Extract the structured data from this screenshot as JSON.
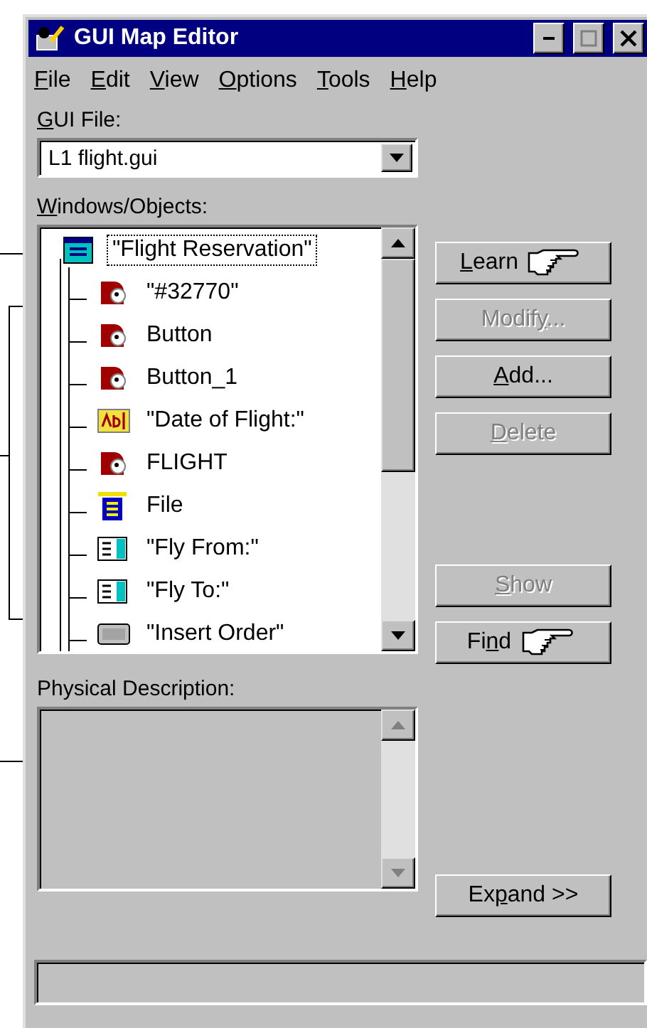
{
  "window": {
    "title": "GUI Map Editor"
  },
  "menu": [
    {
      "key": "F",
      "after": "ile"
    },
    {
      "key": "E",
      "after": "dit"
    },
    {
      "key": "V",
      "after": "iew"
    },
    {
      "key": "O",
      "after": "ptions"
    },
    {
      "key": "T",
      "after": "ools"
    },
    {
      "key": "H",
      "after": "elp"
    }
  ],
  "gui_file": {
    "label": {
      "key": "G",
      "after": "UI File:"
    },
    "value": "L1  flight.gui"
  },
  "objects": {
    "label": {
      "key": "W",
      "after": "indows/Objects:"
    },
    "tree": [
      {
        "label": "\"Flight Reservation\"",
        "kind": "window",
        "selected": true,
        "children": [
          {
            "label": "\"#32770\"",
            "kind": "object",
            "selected": false
          },
          {
            "label": "Button",
            "kind": "object",
            "selected": false
          },
          {
            "label": "Button_1",
            "kind": "object",
            "selected": false
          },
          {
            "label": "\"Date of Flight:\"",
            "kind": "edit",
            "selected": false
          },
          {
            "label": "FLIGHT",
            "kind": "object",
            "selected": false
          },
          {
            "label": "File",
            "kind": "menu",
            "selected": false
          },
          {
            "label": "\"Fly From:\"",
            "kind": "list",
            "selected": false
          },
          {
            "label": "\"Fly To:\"",
            "kind": "list",
            "selected": false
          },
          {
            "label": "\"Insert Order\"",
            "kind": "push",
            "selected": false
          }
        ]
      }
    ]
  },
  "buttons_top": [
    {
      "key": "L",
      "after": "earn",
      "disabled": false,
      "hand": true
    },
    {
      "before": "Modif",
      "key": "y",
      "after": "...",
      "disabled": true
    },
    {
      "key": "A",
      "after": "dd...",
      "disabled": false
    },
    {
      "key": "D",
      "after": "elete",
      "disabled": true
    }
  ],
  "buttons_bottom": [
    {
      "key": "S",
      "after": "how",
      "disabled": true
    },
    {
      "before": "Fi",
      "key": "n",
      "after": "d",
      "disabled": false,
      "hand": true
    }
  ],
  "physical": {
    "label": "Physical Description:"
  },
  "expand_button": {
    "before": "Ex",
    "key": "p",
    "after": "and >>",
    "disabled": false
  }
}
